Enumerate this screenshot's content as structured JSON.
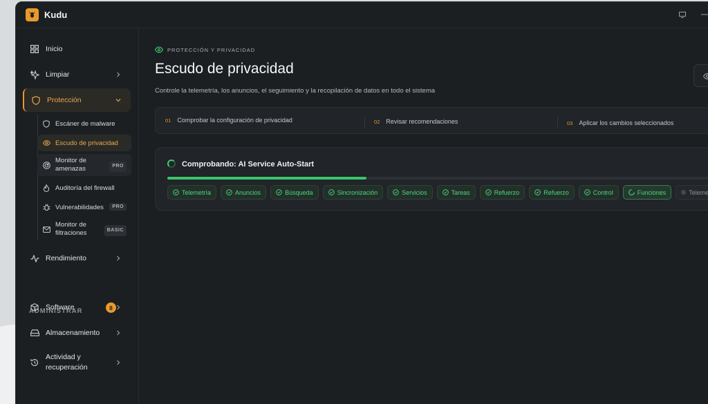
{
  "app": {
    "title": "Kudu"
  },
  "sidebar": {
    "items": [
      {
        "label": "Inicio",
        "icon": "grid-icon"
      },
      {
        "label": "Limpiar",
        "icon": "sparkle-icon"
      },
      {
        "label": "Protección",
        "icon": "shield-icon"
      },
      {
        "label": "Rendimiento",
        "icon": "activity-icon"
      }
    ],
    "protection_sub": [
      {
        "label": "Escáner de malware",
        "icon": "shield-small-icon"
      },
      {
        "label": "Escudo de privacidad",
        "icon": "eye-icon"
      },
      {
        "label_line1": "Monitor de",
        "label_line2": "amenazas",
        "tag": "PRO",
        "icon": "radar-icon"
      },
      {
        "label": "Auditoría del firewall",
        "icon": "flame-icon"
      },
      {
        "label": "Vulnerabilidades",
        "tag": "PRO",
        "icon": "bug-icon"
      },
      {
        "label_line1": "Monitor de",
        "label_line2": "filtraciones",
        "tag": "BASIC",
        "icon": "mail-icon"
      }
    ],
    "section_admin": "ADMINISTRAR",
    "admin_items": [
      {
        "label": "Software",
        "badge": "8",
        "icon": "box-icon"
      },
      {
        "label": "Almacenamiento",
        "icon": "drive-icon"
      },
      {
        "label_line1": "Actividad y",
        "label_line2": "recuperación",
        "icon": "history-icon"
      }
    ]
  },
  "main": {
    "eyebrow": "PROTECCIÓN Y PRIVACIDAD",
    "title": "Escudo de privacidad",
    "subtitle": "Controle la telemetría, los anuncios, el seguimiento y la recopilación de datos en todo el sistema",
    "steps": [
      {
        "num": "01",
        "label": "Comprobar la configuración de privacidad"
      },
      {
        "num": "02",
        "label": "Revisar recomendaciones"
      },
      {
        "num": "03",
        "label": "Aplicar los cambios seleccionados"
      }
    ],
    "check": {
      "title": "Comprobando: AI Service Auto-Start",
      "progress": 0.36,
      "chips": [
        {
          "label": "Telemetría",
          "state": "done"
        },
        {
          "label": "Anuncios",
          "state": "done"
        },
        {
          "label": "Búsqueda",
          "state": "done"
        },
        {
          "label": "Sincronización",
          "state": "done"
        },
        {
          "label": "Servicios",
          "state": "done"
        },
        {
          "label": "Tareas",
          "state": "done"
        },
        {
          "label": "Refuerzo",
          "state": "done"
        },
        {
          "label": "Refuerzo",
          "state": "done"
        },
        {
          "label": "Control",
          "state": "done"
        },
        {
          "label": "Funciones",
          "state": "running"
        },
        {
          "label": "Telemetría",
          "state": "pending"
        }
      ]
    }
  },
  "colors": {
    "accent": "#e99a2b",
    "success": "#3ccf6a",
    "background": "#1c1f22"
  }
}
